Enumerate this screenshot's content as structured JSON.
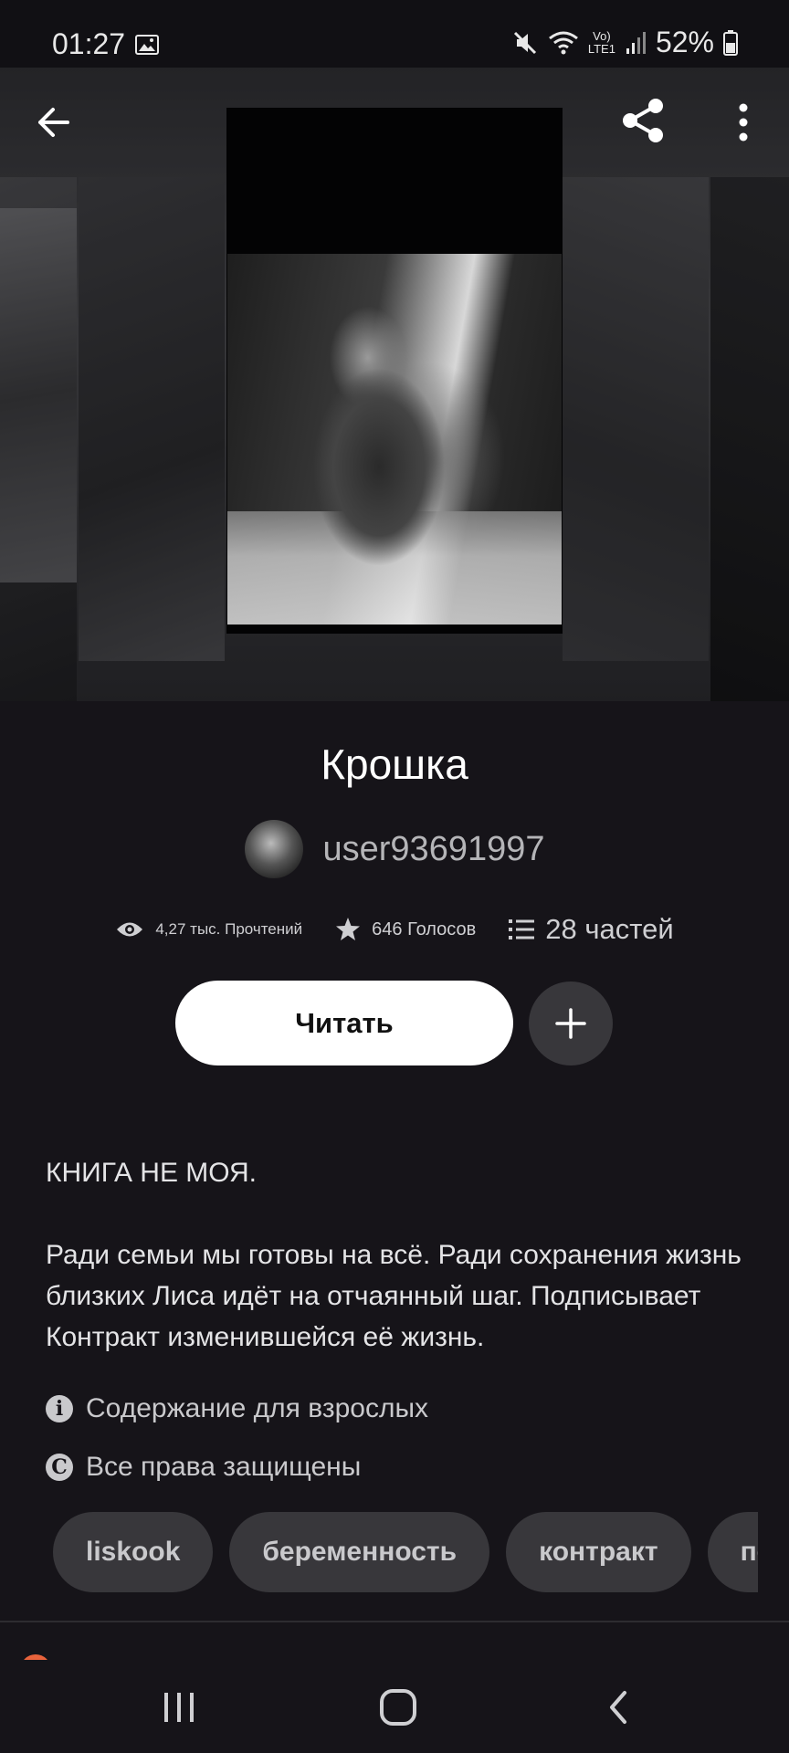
{
  "status_bar": {
    "time": "01:27",
    "battery": "52%",
    "network": "LTE1",
    "icons": [
      "gallery-icon",
      "mute-icon",
      "wifi-icon",
      "volte-icon",
      "signal-icon",
      "battery-icon"
    ]
  },
  "top_bar": {
    "icons": [
      "back-arrow-icon",
      "share-icon",
      "more-vert-icon"
    ]
  },
  "story": {
    "title": "Крошка",
    "author": "user93691997",
    "reads": "4,27 тыс. Прочтений",
    "votes": "646 Голосов",
    "parts": "28 частей"
  },
  "actions": {
    "read_label": "Читать",
    "add_icon": "plus-icon"
  },
  "description": [
    "КНИГА НЕ МОЯ.",
    "Ради семьи мы готовы на всё. Ради сохранения жизнь близких Лиса идёт на отчаянный шаг. Подписывает Контракт изменившейся её жизнь."
  ],
  "meta": {
    "mature": "Содержание для взрослых",
    "rights": "Все права защищены"
  },
  "tags": [
    "liskook",
    "беременность",
    "контракт",
    "пер"
  ],
  "colors": {
    "background": "#161419",
    "read_button_bg": "#ffffff",
    "chip_bg": "#38373b",
    "accent_dot": "#e8633c"
  }
}
